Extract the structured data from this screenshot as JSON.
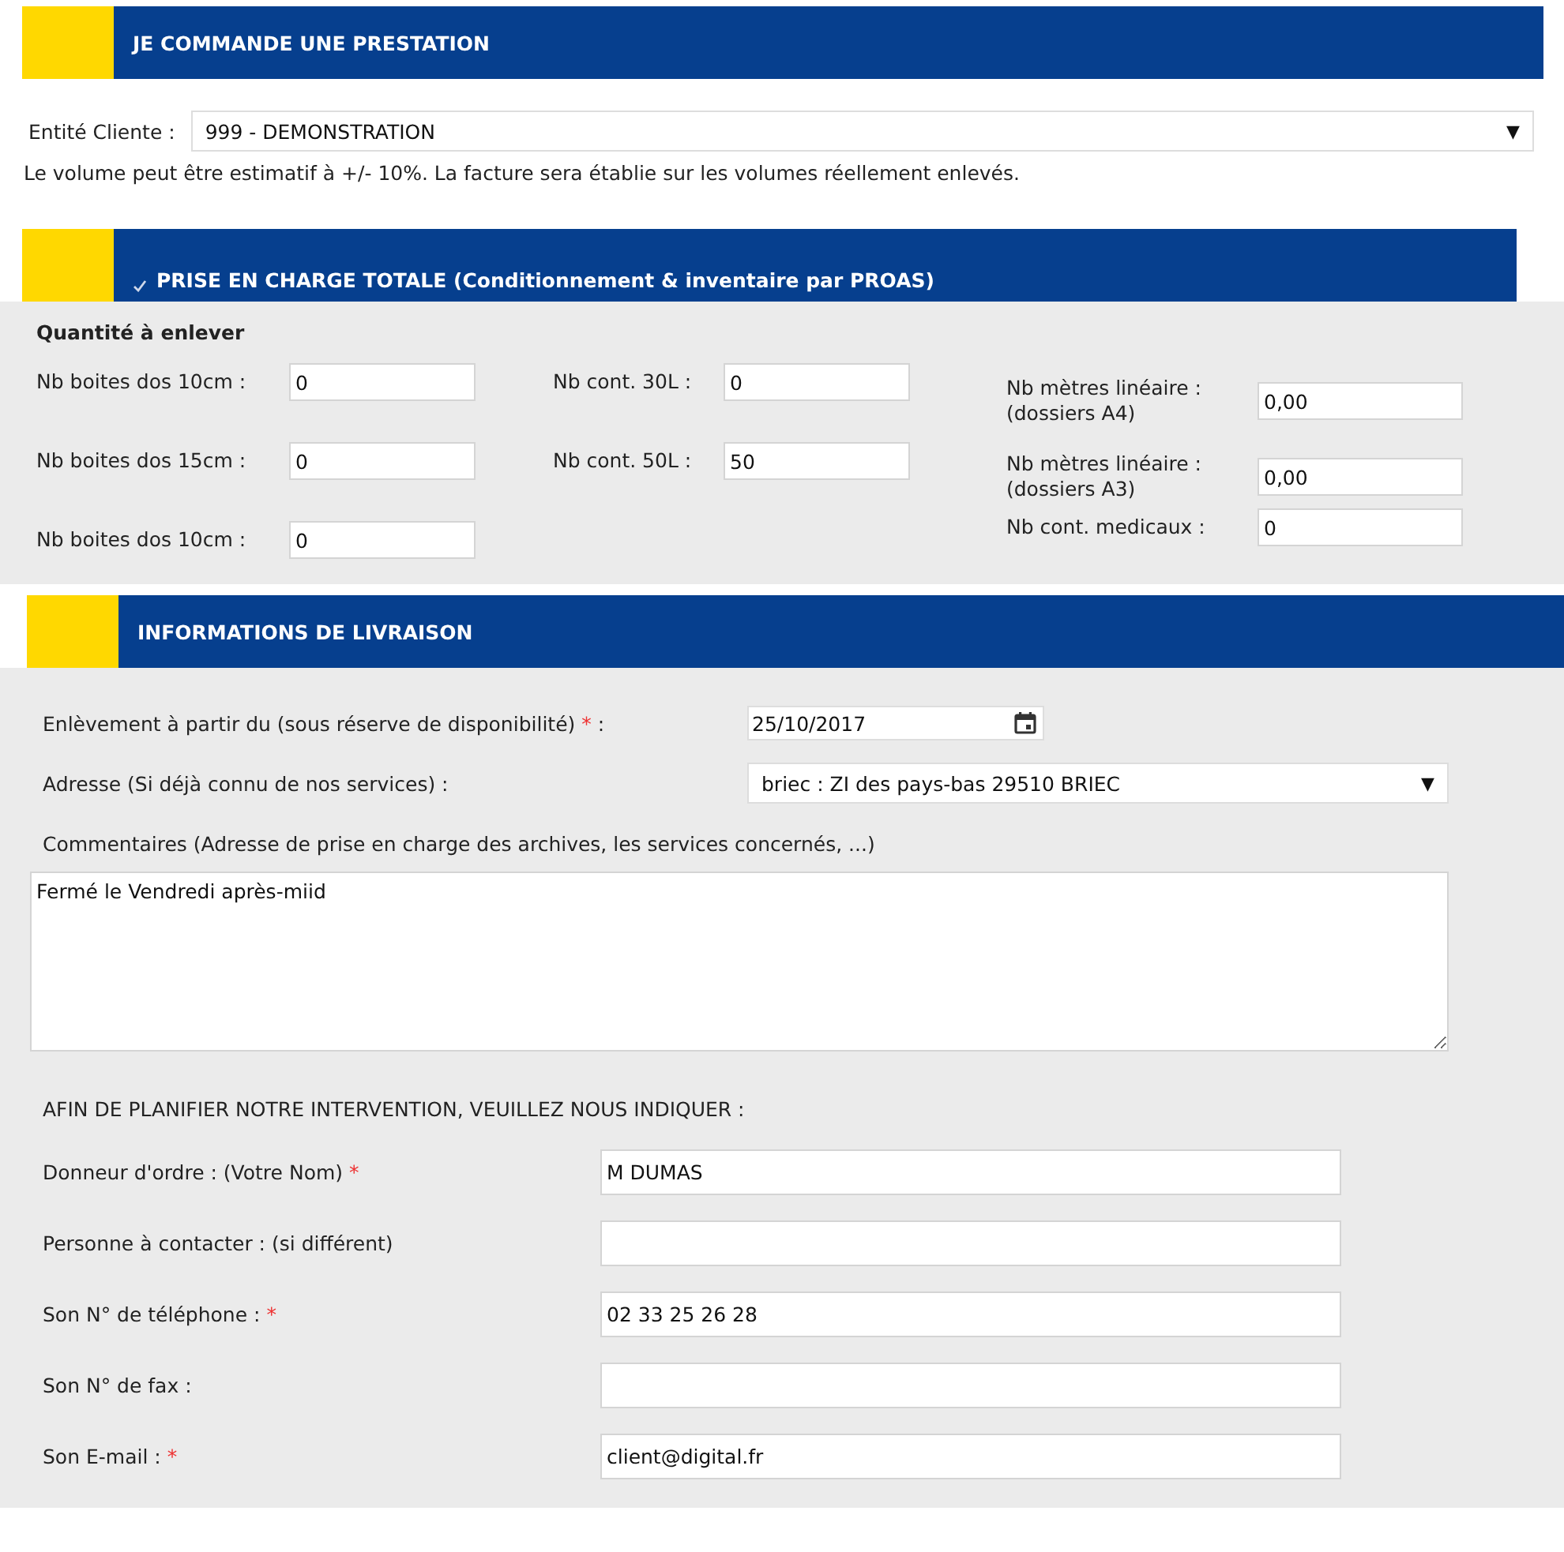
{
  "order_section": {
    "title": "JE COMMANDE UNE PRESTATION",
    "client": {
      "label": "Entité Cliente :",
      "value": "999 - DEMONSTRATION",
      "arrow": "▼"
    },
    "note": "Le volume peut être estimatif à +/- 10%. La facture sera établie sur les volumes réellement enlevés."
  },
  "service_section": {
    "title": "PRISE EN CHARGE TOTALE (Conditionnement & inventaire par PROAS)",
    "checked": true,
    "subtitle": "Quantité à enlever",
    "columns": [
      [
        {
          "label": "Nb boites dos 10cm :",
          "value": "0"
        },
        {
          "label": "Nb boites dos 15cm :",
          "value": "0"
        },
        {
          "label": "Nb boites dos 10cm :",
          "value": "0"
        }
      ],
      [
        {
          "label": "Nb cont. 30L :",
          "value": "0"
        },
        {
          "label": "Nb cont. 50L :",
          "value": "50"
        }
      ],
      [
        {
          "label": "Nb mètres linéaire :\n(dossiers A4)",
          "value": "0,00"
        },
        {
          "label": "Nb mètres linéaire :\n(dossiers A3)",
          "value": "0,00"
        },
        {
          "label": "Nb cont. medicaux :",
          "value": "0"
        }
      ]
    ]
  },
  "delivery_section": {
    "title": "INFORMATIONS DE LIVRAISON",
    "pickup_date": {
      "label": "Enlèvement à partir du (sous réserve de disponibilité)",
      "required_mark": "*",
      "suffix": ":",
      "value": "25/10/2017"
    },
    "address": {
      "label": "Adresse (Si déjà connu de nos services) :",
      "value": "briec : ZI des pays-bas 29510 BRIEC",
      "arrow": "▼"
    },
    "comments": {
      "label": "Commentaires (Adresse de prise en charge des archives, les services concernés, ...)",
      "value": "Fermé le Vendredi après-miid"
    },
    "contact_heading": "AFIN DE PLANIFIER NOTRE INTERVENTION, VEUILLEZ NOUS INDIQUER :",
    "contact_fields": [
      {
        "label": "Donneur d'ordre : (Votre Nom)",
        "required_mark": "*",
        "value": "M DUMAS"
      },
      {
        "label": "Personne à contacter : (si différent)"
      },
      {
        "label": "Son N° de téléphone :",
        "required_mark": "*",
        "value": "02 33 25 26 28"
      },
      {
        "label": "Son N° de fax :"
      },
      {
        "label": "Son E-mail :",
        "required_mark": "*",
        "value": "client@digital.fr"
      }
    ]
  }
}
